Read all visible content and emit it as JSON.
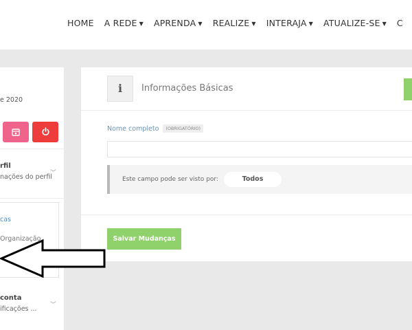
{
  "nav": {
    "items": [
      {
        "label": "HOME",
        "chevron": false
      },
      {
        "label": "A REDE",
        "chevron": true
      },
      {
        "label": "APRENDA",
        "chevron": true
      },
      {
        "label": "REALIZE",
        "chevron": true
      },
      {
        "label": "INTERAJA",
        "chevron": true
      },
      {
        "label": "ATUALIZE-SE",
        "chevron": true
      },
      {
        "label": "C",
        "chevron": false
      }
    ]
  },
  "sidebar": {
    "date_fragment": "e 2020",
    "profile_section": {
      "title": "rfil",
      "subtitle": "nações do perfil"
    },
    "active_section": {
      "link_active": "cas",
      "link_second": "Organização"
    },
    "account_section": {
      "title": "conta",
      "subtitle": "ificações ..."
    },
    "icons": {
      "pink_button": "calendar-icon",
      "red_button": "power-icon"
    }
  },
  "card": {
    "icon": "info-icon",
    "icon_glyph": "i",
    "title": "Informações Básicas",
    "field": {
      "label": "Nome completo",
      "required_badge": "(OBRIGATÓRIO)",
      "value": "",
      "placeholder": ""
    },
    "visibility": {
      "label": "Este campo pode ser visto por:",
      "value": "Todos"
    },
    "save_label": "Salvar Mudanças"
  },
  "colors": {
    "accent_green": "#8fd16a",
    "pink": "#f0648c",
    "red": "#ee3b3b",
    "link_blue": "#4a90c8",
    "background_gray": "#e9e9e9"
  }
}
